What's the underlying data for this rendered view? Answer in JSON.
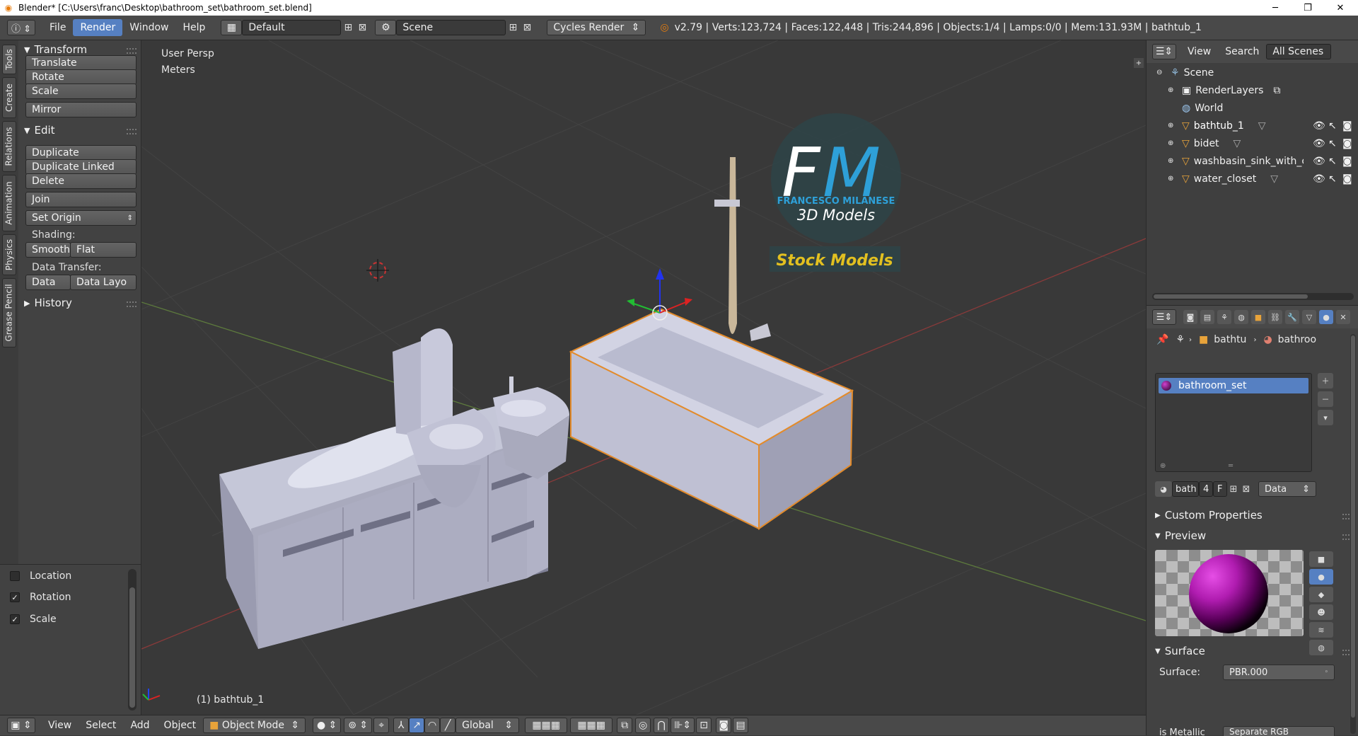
{
  "titlebar": {
    "title": "Blender* [C:\\Users\\franc\\Desktop\\bathroom_set\\bathroom_set.blend]",
    "minimize": "─",
    "maximize": "❐",
    "close": "✕"
  },
  "infobar": {
    "menus": [
      "File",
      "Render",
      "Window",
      "Help"
    ],
    "active_menu": "Render",
    "layout_name": "Default",
    "scene_name": "Scene",
    "engine": "Cycles Render",
    "stats": "v2.79 | Verts:123,724 | Faces:122,448 | Tris:244,896 | Objects:1/4 | Lamps:0/0 | Mem:131.93M | bathtub_1"
  },
  "tool_tabs": [
    "Tools",
    "Create",
    "Relations",
    "Animation",
    "Physics",
    "Grease Pencil"
  ],
  "toolshelf": {
    "transform": {
      "title": "Transform",
      "buttons": [
        "Translate",
        "Rotate",
        "Scale"
      ],
      "mirror": "Mirror"
    },
    "edit": {
      "title": "Edit",
      "buttons": [
        "Duplicate",
        "Duplicate Linked",
        "Delete"
      ],
      "join": "Join",
      "set_origin": "Set Origin"
    },
    "shading": {
      "label": "Shading:",
      "smooth": "Smooth",
      "flat": "Flat"
    },
    "data_transfer": {
      "label": "Data Transfer:",
      "data": "Data",
      "data_layout": "Data Layo"
    },
    "history": {
      "title": "History"
    }
  },
  "operator": {
    "options": [
      {
        "label": "Location",
        "checked": false
      },
      {
        "label": "Rotation",
        "checked": true
      },
      {
        "label": "Scale",
        "checked": true
      }
    ]
  },
  "viewport": {
    "view_label": "User Persp",
    "units_label": "Meters",
    "object_label": "(1) bathtub_1",
    "watermark": {
      "letters_f": "F",
      "letters_m": "M",
      "line1": "FRANCESCO MILANESE",
      "line2": "3D Models",
      "banner": "Stock Models"
    }
  },
  "bottombar": {
    "menus": [
      "View",
      "Select",
      "Add",
      "Object"
    ],
    "mode": "Object Mode",
    "orientation": "Global"
  },
  "outliner": {
    "tabs": [
      "View",
      "Search",
      "All Scenes"
    ],
    "tree": [
      {
        "label": "Scene",
        "level": 0,
        "icon": "scene-icon"
      },
      {
        "label": "RenderLayers",
        "level": 1,
        "icon": "renderlayers-icon"
      },
      {
        "label": "World",
        "level": 1,
        "icon": "world-icon"
      },
      {
        "label": "bathtub_1",
        "level": 1,
        "icon": "mesh-object-icon",
        "selected": true
      },
      {
        "label": "bidet",
        "level": 1,
        "icon": "mesh-object-icon"
      },
      {
        "label": "washbasin_sink_with_c",
        "level": 1,
        "icon": "mesh-object-icon"
      },
      {
        "label": "water_closet",
        "level": 1,
        "icon": "mesh-object-icon"
      }
    ]
  },
  "properties": {
    "breadcrumb": [
      "bathtu",
      "bathroo"
    ],
    "material_slot": "bathroom_set",
    "datablock": {
      "name": "bath",
      "users": "4",
      "fake": "F",
      "link": "Data"
    },
    "sections": {
      "custom": "Custom Properties",
      "preview": "Preview",
      "surface": "Surface"
    },
    "surface": {
      "label": "Surface:",
      "value": "PBR.000"
    },
    "metallic": {
      "label": "is Metallic",
      "value": "Separate RGB"
    }
  },
  "colors": {
    "accent": "#5680c2",
    "selection": "#e38b2b",
    "watermark_blue": "#2ea0d8",
    "watermark_gold": "#e2c020"
  }
}
